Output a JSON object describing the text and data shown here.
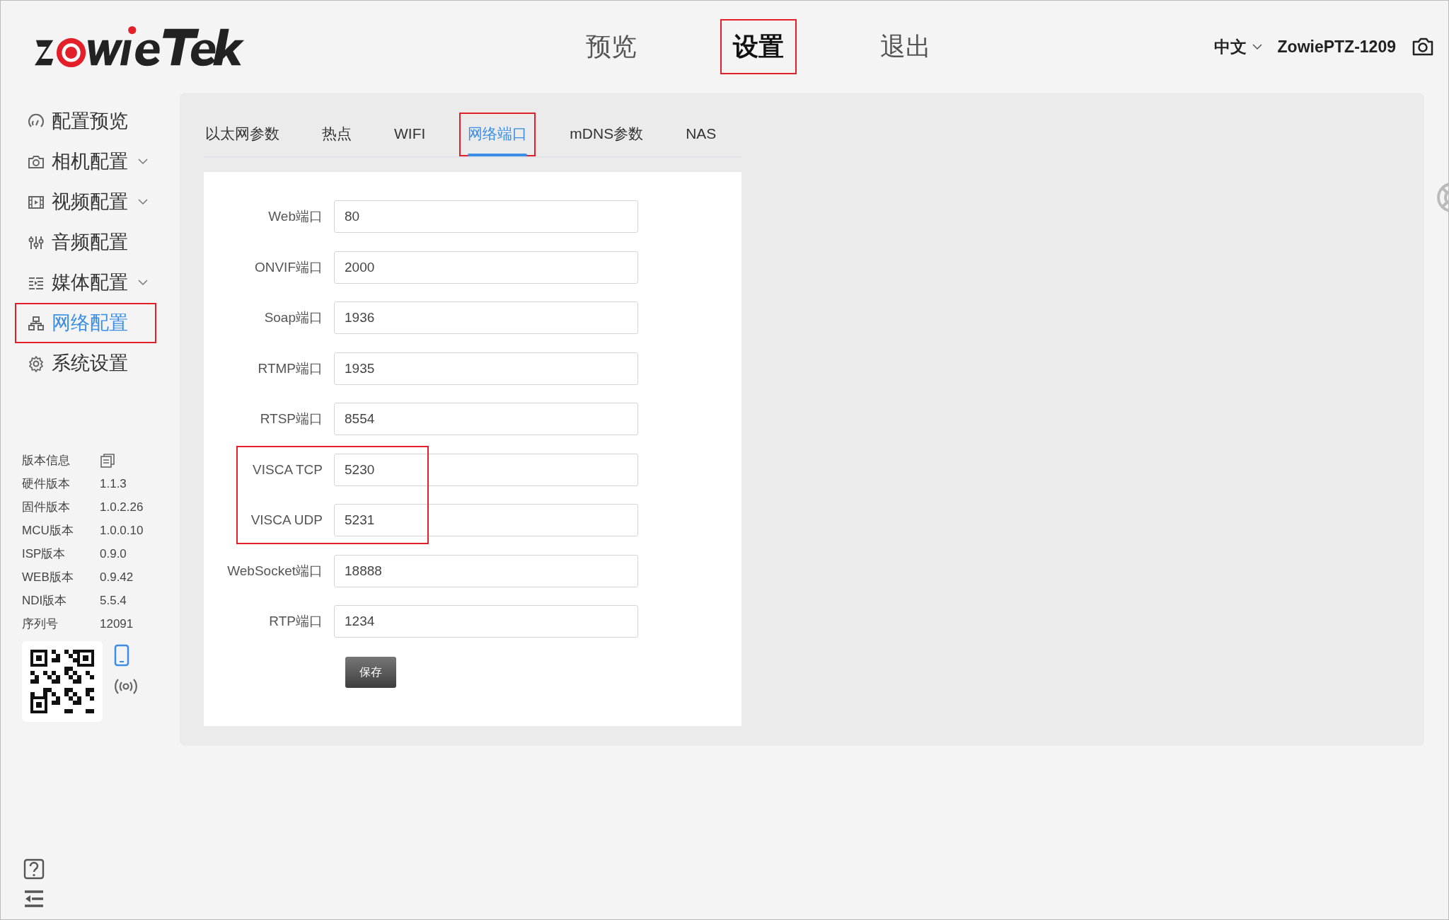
{
  "header": {
    "nav": [
      {
        "label": "预览",
        "selected": false,
        "highlighted": false
      },
      {
        "label": "设置",
        "selected": true,
        "highlighted": true
      },
      {
        "label": "退出",
        "selected": false,
        "highlighted": false
      }
    ],
    "language": "中文",
    "device": "ZowiePTZ-1209"
  },
  "sidebar": {
    "items": [
      {
        "label": "配置预览",
        "expandable": false,
        "selected": false,
        "highlighted": false
      },
      {
        "label": "相机配置",
        "expandable": true,
        "selected": false,
        "highlighted": false
      },
      {
        "label": "视频配置",
        "expandable": true,
        "selected": false,
        "highlighted": false
      },
      {
        "label": "音频配置",
        "expandable": false,
        "selected": false,
        "highlighted": false
      },
      {
        "label": "媒体配置",
        "expandable": true,
        "selected": false,
        "highlighted": false
      },
      {
        "label": "网络配置",
        "expandable": false,
        "selected": true,
        "highlighted": true
      },
      {
        "label": "系统设置",
        "expandable": false,
        "selected": false,
        "highlighted": false
      }
    ],
    "version_title": "版本信息",
    "versions": [
      {
        "label": "硬件版本",
        "value": "1.1.3"
      },
      {
        "label": "固件版本",
        "value": "1.0.2.26"
      },
      {
        "label": "MCU版本",
        "value": "1.0.0.10"
      },
      {
        "label": "ISP版本",
        "value": "0.9.0"
      },
      {
        "label": "WEB版本",
        "value": "0.9.42"
      },
      {
        "label": "NDI版本",
        "value": "5.5.4"
      },
      {
        "label": "序列号",
        "value": "12091"
      }
    ]
  },
  "tabs": [
    {
      "label": "以太网参数",
      "selected": false,
      "highlighted": false
    },
    {
      "label": "热点",
      "selected": false,
      "highlighted": false
    },
    {
      "label": "WIFI",
      "selected": false,
      "highlighted": false
    },
    {
      "label": "网络端口",
      "selected": true,
      "highlighted": true
    },
    {
      "label": "mDNS参数",
      "selected": false,
      "highlighted": false
    },
    {
      "label": "NAS",
      "selected": false,
      "highlighted": false
    }
  ],
  "fields": [
    {
      "label": "Web端口",
      "value": "80",
      "highlighted": false
    },
    {
      "label": "ONVIF端口",
      "value": "2000",
      "highlighted": false
    },
    {
      "label": "Soap端口",
      "value": "1936",
      "highlighted": false
    },
    {
      "label": "RTMP端口",
      "value": "1935",
      "highlighted": false
    },
    {
      "label": "RTSP端口",
      "value": "8554",
      "highlighted": false
    },
    {
      "label": "VISCA TCP",
      "value": "5230",
      "highlighted": true
    },
    {
      "label": "VISCA UDP",
      "value": "5231",
      "highlighted": true
    },
    {
      "label": "WebSocket端口",
      "value": "18888",
      "highlighted": false
    },
    {
      "label": "RTP端口",
      "value": "1234",
      "highlighted": false
    }
  ],
  "save_button": "保存"
}
